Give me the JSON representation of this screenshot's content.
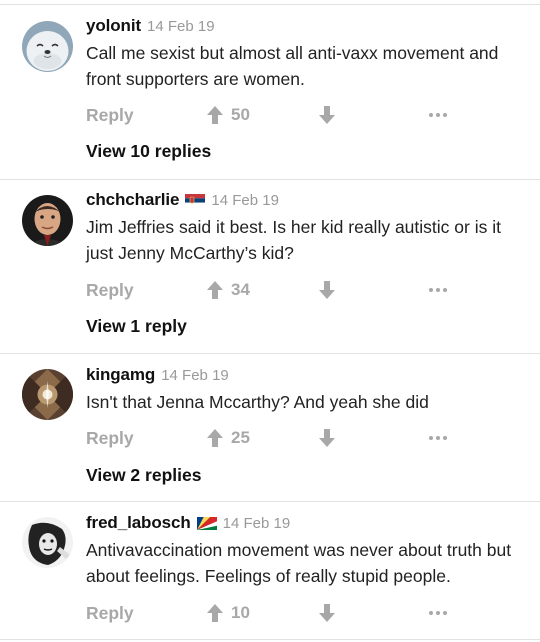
{
  "comments": [
    {
      "username": "yolonit",
      "time": "14 Feb 19",
      "text": "Call me sexist but almost all anti-vaxx movement and front supporters are women.",
      "reply_label": "Reply",
      "votes": "50",
      "view_replies": "View 10 replies"
    },
    {
      "username": "chchcharlie",
      "time": "14 Feb 19",
      "text": "Jim Jeffries said it best. Is her kid really autistic or is it just Jenny McCarthy’s kid?",
      "reply_label": "Reply",
      "votes": "34",
      "view_replies": "View 1 reply"
    },
    {
      "username": "kingamg",
      "time": "14 Feb 19",
      "text": "Isn't that Jenna Mccarthy? And yeah she did",
      "reply_label": "Reply",
      "votes": "25",
      "view_replies": "View 2 replies"
    },
    {
      "username": "fred_labosch",
      "time": "14 Feb 19",
      "text": "Antivavaccination movement was never about truth but about feelings. Feelings of really stupid people.",
      "reply_label": "Reply",
      "votes": "10"
    }
  ],
  "icons": {
    "upvote": "arrow-up-icon",
    "downvote": "arrow-down-icon",
    "more": "more-dots-icon"
  },
  "colors": {
    "muted": "#a8a8a8",
    "divider": "#e2e2e2",
    "text": "#222222"
  }
}
